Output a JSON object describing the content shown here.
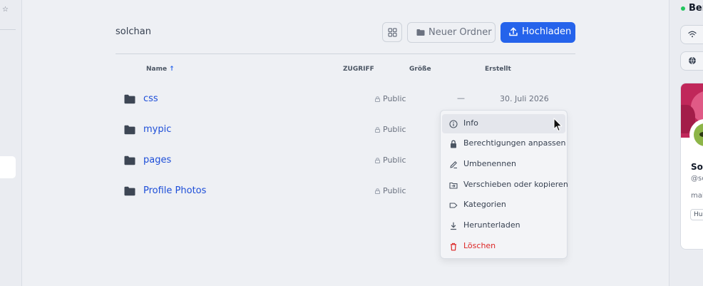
{
  "sidebar_right": {
    "status_label": "Ber",
    "profile": {
      "name": "Sol",
      "handle": "@sc",
      "bio": "mai",
      "tag": "Hu"
    }
  },
  "header": {
    "breadcrumb": "solchan",
    "new_folder_label": "Neuer Ordner",
    "upload_label": "Hochladen"
  },
  "table": {
    "columns": {
      "name": "Name",
      "name_sort": "↑",
      "access": "ZUGRIFF",
      "size": "Größe",
      "created": "Erstellt"
    },
    "rows": [
      {
        "name": "css",
        "access": "Public",
        "size": "—",
        "created": "30. Juli 2026"
      },
      {
        "name": "mypic",
        "access": "Public",
        "size": "",
        "created": ""
      },
      {
        "name": "pages",
        "access": "Public",
        "size": "",
        "created": ""
      },
      {
        "name": "Profile Photos",
        "access": "Public",
        "size": "",
        "created": ""
      }
    ]
  },
  "context_menu": {
    "items": [
      {
        "label": "Info",
        "icon": "info-icon"
      },
      {
        "label": "Berechtigungen anpassen",
        "icon": "lock-icon"
      },
      {
        "label": "Umbenennen",
        "icon": "pencil-icon"
      },
      {
        "label": "Verschieben oder kopieren",
        "icon": "move-folder-icon"
      },
      {
        "label": "Kategorien",
        "icon": "tag-icon"
      },
      {
        "label": "Herunterladen",
        "icon": "download-icon"
      },
      {
        "label": "Löschen",
        "icon": "trash-icon"
      }
    ]
  },
  "colors": {
    "accent": "#2563eb",
    "link": "#1d4ed8",
    "danger": "#dc2626",
    "online": "#22c55e"
  }
}
